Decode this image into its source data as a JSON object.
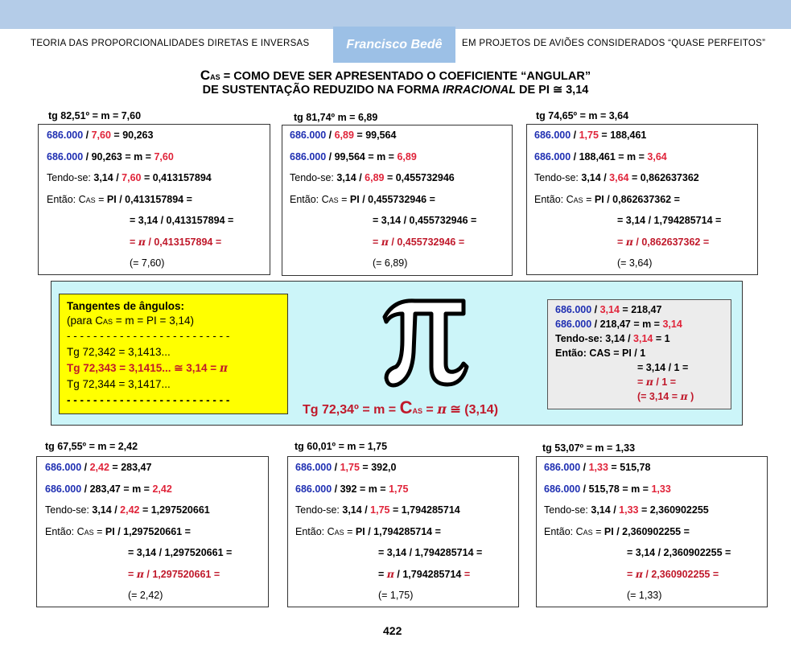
{
  "header": {
    "left_text": "TEORIA DAS PROPORCIONALIDADES  DIRETAS E INVERSAS",
    "author": "Francisco Bedê",
    "right_text": "EM PROJETOS  DE AVIÕES CONSIDERADOS “QUASE PERFEITOS”"
  },
  "title": {
    "c": "C",
    "sub": "AS",
    "line1_rest": "= COMO DEVE SER APRESENTADO O COEFICIENTE “ANGULAR”",
    "line2_a": "DE SUSTENTAÇÃO REDUZIDO NA FORMA ",
    "line2_italic": "IRRACIONAL",
    "line2_b": " DE PI ",
    "approx": "≅",
    "line2_c": " 3,14"
  },
  "common": {
    "num": "686.000",
    "slash": " / ",
    "eq": " = ",
    "tendo": "Tendo-se: ",
    "pi_val": "3,14",
    "entao": "Então: C",
    "as": "AS",
    "pi_word": "PI",
    "pi_sym": "π"
  },
  "boxes": [
    {
      "label": "tg 82,51º = m = 7,60",
      "m": "7,60",
      "q": "90,263",
      "r": "0,413157894",
      "last": "(=  7,60)"
    },
    {
      "label": "tg 81,74º  m = 6,89",
      "m": "6,89",
      "q": "99,564",
      "r": "0,455732946",
      "last": "(=  6,89)"
    },
    {
      "label": "tg 74,65º = m = 3,64",
      "m1": "1,75",
      "q": "188,461",
      "m": "3,64",
      "tr": "1,794285714",
      "r": "0,862637362",
      "last": "(=  3,64)"
    },
    {
      "label": "tg 67,55º = m = 2,42",
      "m": "2,42",
      "q": "283,47",
      "r": "1,297520661",
      "last": "(=  2,42)"
    },
    {
      "label": "tg 60,01º = m = 1,75",
      "m": "1,75",
      "q": "392,0",
      "q2": "392",
      "r": "1,794285714",
      "last": "(=  1,75)"
    },
    {
      "label": "tg 53,07º = m = 1,33",
      "m": "1,33",
      "q": "515,78",
      "r": "2,360902255",
      "last": "(=  1,33)"
    }
  ],
  "yellow": {
    "title": "Tangentes de ângulos:",
    "sub_a": "(para C",
    "sub_b": " = m = PI = 3,14)",
    "dash": "- - - - - - - - - - - - - - - - - - - - - - - - -",
    "t1": "Tg 72,342 = 3,1413...",
    "t2": "Tg 72,343 = 3,1415...  ≅  3,14  =  ",
    "t3": "Tg 72,344 = 3,1417..."
  },
  "center": {
    "pi_glyph": "π",
    "formula_a": "Tg 72,34º = m = ",
    "c": "C",
    "sub": "AS",
    "formula_b": " =  ",
    "formula_c": "  ≅ (3,14)"
  },
  "gray": {
    "l1_q": "218,47",
    "l2_q": "218,47",
    "l2_m": "3,14",
    "l3": "Tendo-se: 3,14  / ",
    "l3_b": " = 1",
    "l4": "Então:  CAS  =  PI / 1",
    "l5": "= 3,14 / 1 =",
    "l6_b": " / 1 =",
    "l7": "(= 3,14 = ",
    "l7_b": " )"
  },
  "page_number": "422"
}
